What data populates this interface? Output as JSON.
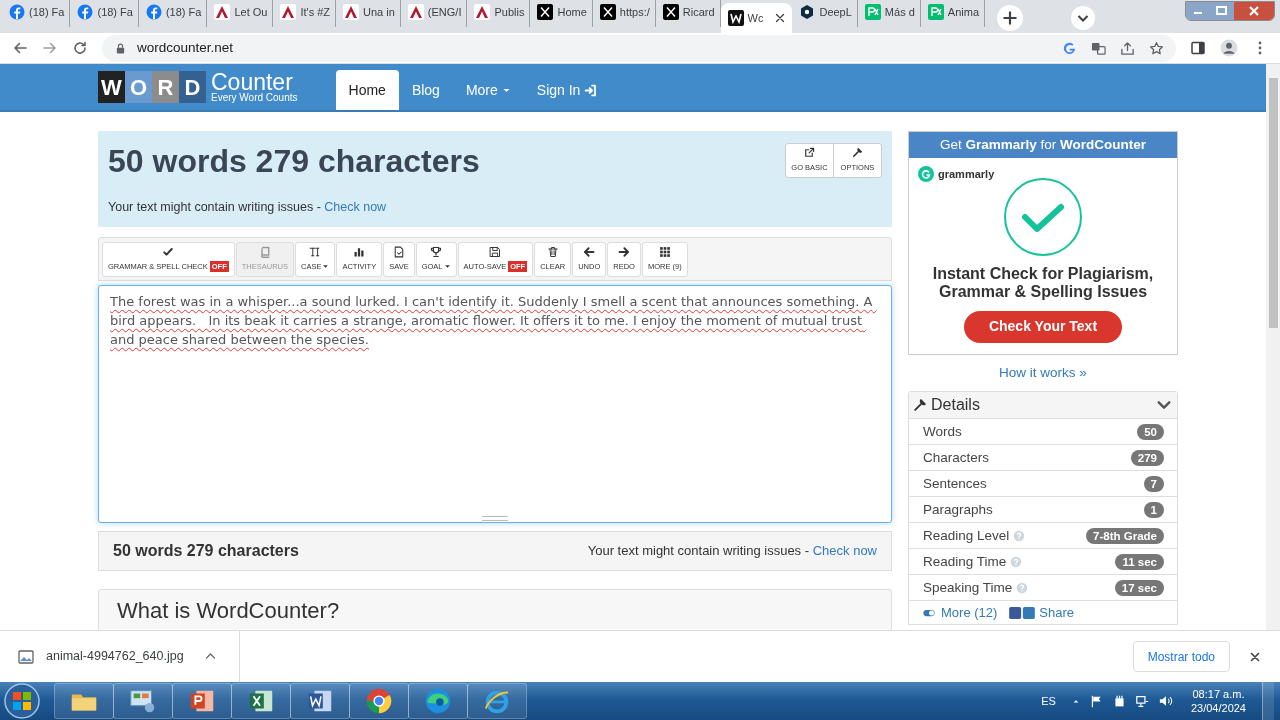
{
  "browser": {
    "tabs": [
      {
        "label": "(18) Fa",
        "kind": "facebook",
        "selected": false
      },
      {
        "label": "(18) Fa",
        "kind": "facebook",
        "selected": false
      },
      {
        "label": "(18) Fa",
        "kind": "facebook",
        "selected": false
      },
      {
        "label": "Let Ou",
        "kind": "triangle",
        "selected": false
      },
      {
        "label": "It's #Z",
        "kind": "triangle",
        "selected": false
      },
      {
        "label": "Una in",
        "kind": "triangle",
        "selected": false
      },
      {
        "label": "(ENG/I",
        "kind": "triangle",
        "selected": false
      },
      {
        "label": "Publis",
        "kind": "triangle",
        "selected": false
      },
      {
        "label": "Home",
        "kind": "x",
        "selected": false
      },
      {
        "label": "https:/",
        "kind": "x",
        "selected": false
      },
      {
        "label": "Ricard",
        "kind": "x",
        "selected": false
      },
      {
        "label": "Wc",
        "kind": "w",
        "selected": true
      },
      {
        "label": "DeepL",
        "kind": "hex",
        "selected": false
      },
      {
        "label": "Más d",
        "kind": "px",
        "selected": false
      },
      {
        "label": "Anima",
        "kind": "px",
        "selected": false
      }
    ],
    "address": "wordcounter.net"
  },
  "site": {
    "logo_letters": [
      "W",
      "O",
      "R",
      "D"
    ],
    "logo_word": "Counter",
    "logo_tagline": "Every Word Counts",
    "nav": [
      {
        "label": "Home",
        "kind": "plain",
        "selected": true
      },
      {
        "label": "Blog",
        "kind": "plain",
        "selected": false
      },
      {
        "label": "More",
        "kind": "dropdown",
        "selected": false
      },
      {
        "label": "Sign In",
        "kind": "signin",
        "selected": false
      }
    ]
  },
  "summary": {
    "title": "50 words 279 characters",
    "notice": "Your text might contain writing issues - ",
    "link": "Check now",
    "buttons": [
      {
        "label": "GO BASIC",
        "kind": "external"
      },
      {
        "label": "OPTIONS",
        "kind": "wrench"
      }
    ]
  },
  "toolbar": [
    {
      "label": "GRAMMAR & SPELL CHECK",
      "kind": "check",
      "badge": "OFF",
      "disabled": false,
      "dropdown": false
    },
    {
      "label": "THESAURUS",
      "kind": "book",
      "disabled": true,
      "dropdown": false
    },
    {
      "label": "CASE",
      "kind": "case",
      "disabled": false,
      "dropdown": true
    },
    {
      "label": "ACTIVITY",
      "kind": "bars",
      "disabled": false,
      "dropdown": false
    },
    {
      "label": "SAVE",
      "kind": "save",
      "disabled": false,
      "dropdown": false
    },
    {
      "label": "GOAL",
      "kind": "trophy",
      "disabled": false,
      "dropdown": true
    },
    {
      "label": "AUTO-SAVE",
      "kind": "floppy",
      "badge": "OFF",
      "disabled": false,
      "dropdown": false
    },
    {
      "label": "CLEAR",
      "kind": "trash",
      "disabled": false,
      "dropdown": false
    },
    {
      "label": "UNDO",
      "kind": "left",
      "disabled": false,
      "dropdown": false
    },
    {
      "label": "REDO",
      "kind": "right",
      "disabled": false,
      "dropdown": false
    },
    {
      "label": "MORE (9)",
      "kind": "grid",
      "disabled": false,
      "dropdown": false
    }
  ],
  "editor": {
    "text": "The forest was in a whisper...a sound lurked. I can't identify it. Suddenly I smell a scent that announces something. A bird appears.   In its beak it carries a strange, aromatic flower. It offers it to me. I enjoy the moment of mutual trust and peace shared between the species."
  },
  "footer": {
    "count": "50 words 279 characters",
    "notice": "Your text might contain writing issues - ",
    "link": "Check now"
  },
  "section_heading": "What is WordCounter?",
  "ad": {
    "header": "Get **Grammarly** for **WordCounter**",
    "brand": "grammarly",
    "headline": "Instant Check for Plagiarism, Grammar & Spelling Issues",
    "button": "Check Your Text",
    "link": "How it works »"
  },
  "details": {
    "title": "Details",
    "rows": [
      {
        "label": "Words",
        "value": "50",
        "help": false
      },
      {
        "label": "Characters",
        "value": "279",
        "help": false
      },
      {
        "label": "Sentences",
        "value": "7",
        "help": false
      },
      {
        "label": "Paragraphs",
        "value": "1",
        "help": false
      },
      {
        "label": "Reading Level",
        "value": "7-8th Grade",
        "help": true
      },
      {
        "label": "Reading Time",
        "value": "11 sec",
        "help": true
      },
      {
        "label": "Speaking Time",
        "value": "17 sec",
        "help": true
      }
    ],
    "more": "More (12)",
    "share": "Share"
  },
  "downloads": {
    "file": "animal-4994762_640.jpg",
    "show_all": "Mostrar todo"
  },
  "taskbar": {
    "apps": [
      {
        "kind": "folder"
      },
      {
        "kind": "control"
      },
      {
        "kind": "slides"
      },
      {
        "kind": "sheet"
      },
      {
        "kind": "doc"
      },
      {
        "kind": "chrome"
      },
      {
        "kind": "edge"
      },
      {
        "kind": "ie"
      }
    ],
    "language": "ES",
    "time": "08:17 a.m.",
    "date": "23/04/2024"
  }
}
